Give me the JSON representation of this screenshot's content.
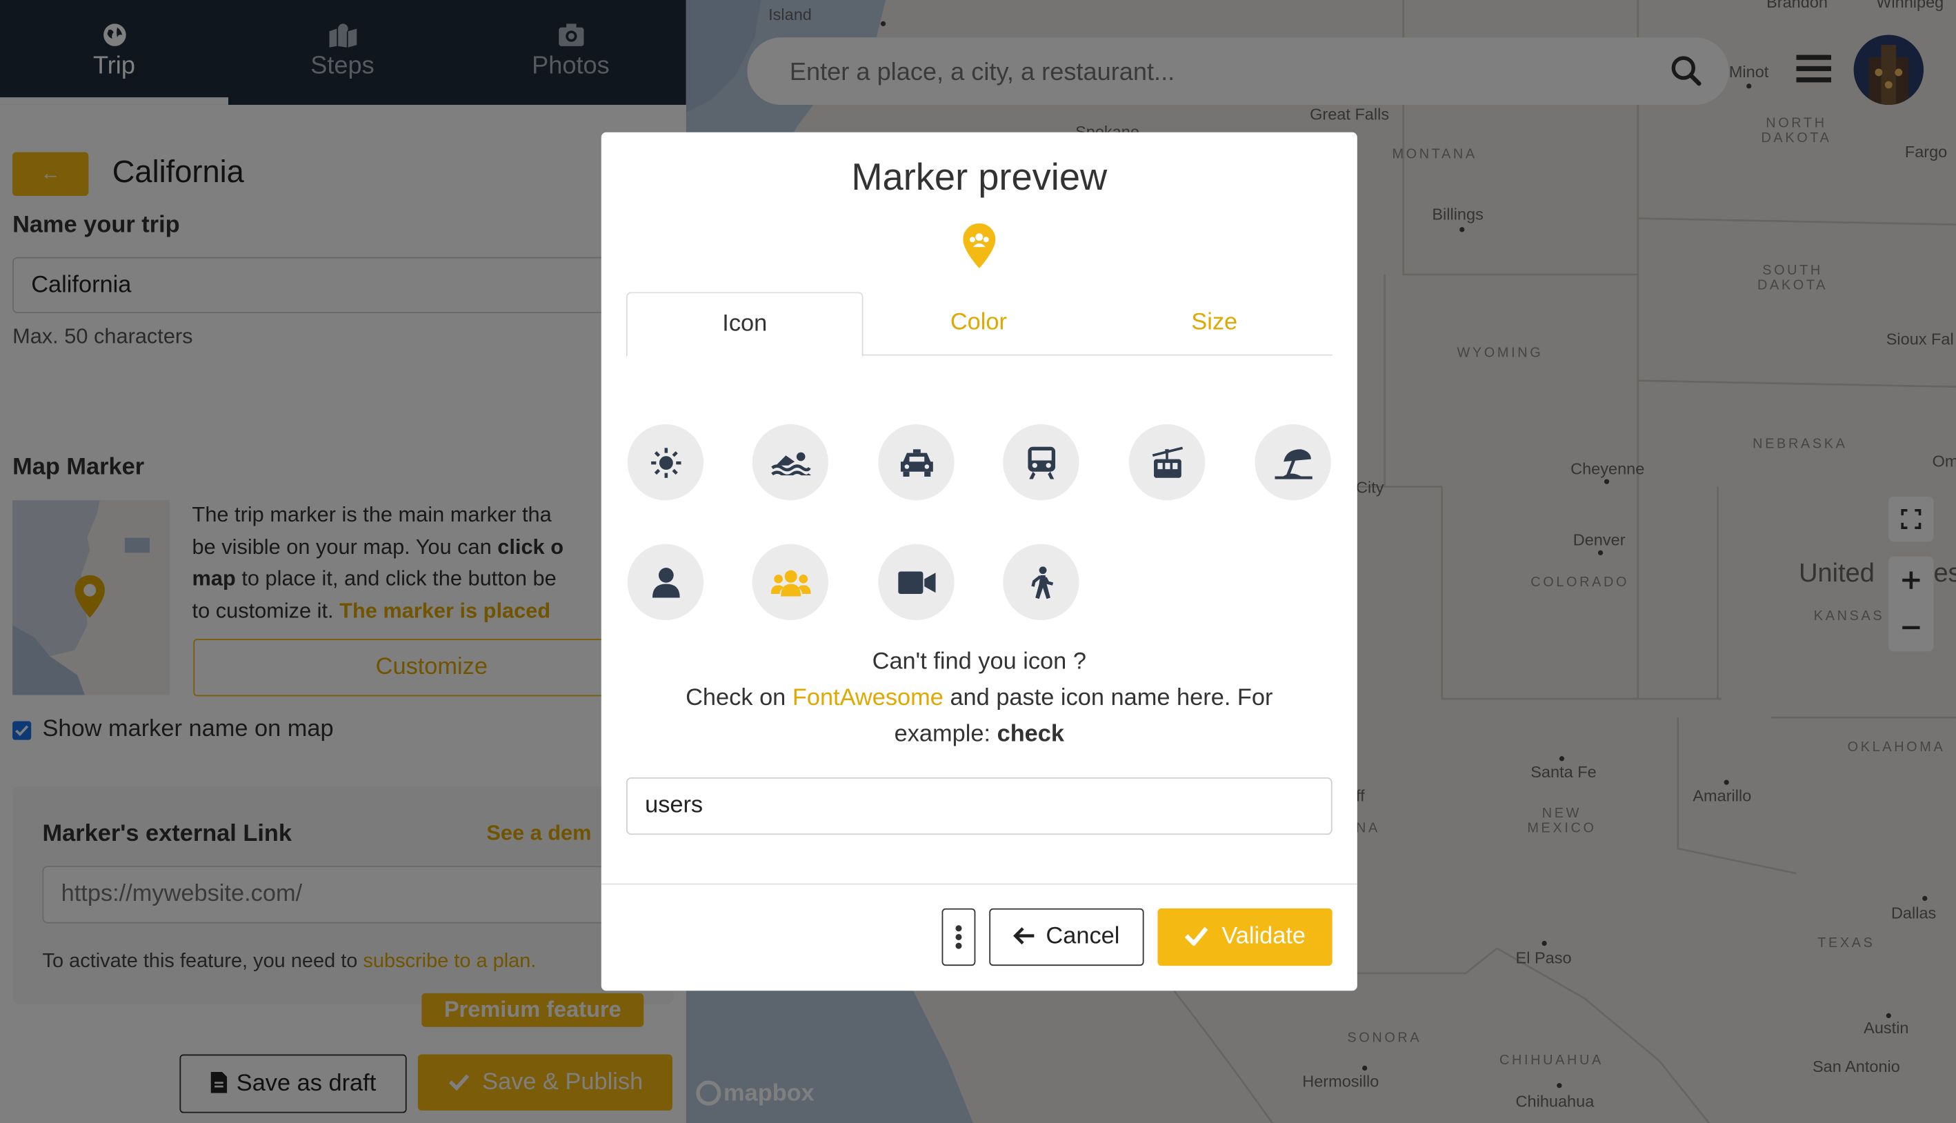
{
  "tabs": [
    {
      "label": "Trip",
      "icon": "globe-icon",
      "active": true
    },
    {
      "label": "Steps",
      "icon": "map-marked-icon",
      "active": false
    },
    {
      "label": "Photos",
      "icon": "camera-icon",
      "active": false
    }
  ],
  "trip": {
    "title": "California",
    "name_label": "Name your trip",
    "name_value": "California",
    "name_hint": "Max. 50 characters"
  },
  "marker": {
    "section_label": "Map Marker",
    "desc_1": "The trip marker is the main marker tha",
    "desc_2a": "be visible on your map. You can ",
    "desc_2b": "click o",
    "desc_3a": "map",
    "desc_3b": " to place it, and click the button be",
    "desc_4a": "to customize it. ",
    "desc_4b": "The marker is placed",
    "customize_label": "Customize",
    "show_name_label": "Show marker name on map",
    "show_name_checked": true
  },
  "external_link": {
    "label": "Marker's external Link",
    "demo_link": "See a dem",
    "placeholder": "https://mywebsite.com/",
    "notice": "To activate this feature, you need to ",
    "notice_link": "subscribe to a plan.",
    "premium_badge": "Premium feature"
  },
  "footer_buttons": {
    "draft": "Save as draft",
    "publish": "Save & Publish"
  },
  "search": {
    "placeholder": "Enter a place, a city, a restaurant..."
  },
  "map": {
    "attribution": "mapbox",
    "labels": [
      "Island",
      "Great Falls",
      "Spokane",
      "MONTANA",
      "Billings",
      "NORTH DAKOTA",
      "Fargo",
      "SOUTH DAKOTA",
      "WYOMING",
      "Sioux Fal",
      "NEBRASKA",
      "Cheyenne",
      "City",
      "Om",
      "Denver",
      "COLORADO",
      "United",
      "es",
      "KANSAS",
      "OKLAHOMA",
      "Amarillo",
      "Santa Fe",
      "NEW MEXICO",
      "ff",
      "NA",
      "Dallas",
      "TEXAS",
      "El Paso",
      "SONORA",
      "Hermosillo",
      "CHIHUAHUA",
      "Chihuahua",
      "Austin",
      "San Antonio",
      "Minot",
      "Brandon",
      "Winnipeg"
    ]
  },
  "modal": {
    "title": "Marker preview",
    "tabs": [
      "Icon",
      "Color",
      "Size"
    ],
    "icons": [
      "sun-icon",
      "swimmer-icon",
      "taxi-icon",
      "train-icon",
      "tram-icon",
      "umbrella-beach-icon",
      "user-icon",
      "users-icon",
      "video-icon",
      "walking-icon"
    ],
    "help_line1": "Can't find you icon ?",
    "help_line2a": "Check on ",
    "help_link": "FontAwesome",
    "help_line2b": " and paste icon name here. For",
    "help_line3a": "example: ",
    "help_example": "check",
    "icon_input_value": "users",
    "cancel_label": "Cancel",
    "validate_label": "Validate"
  },
  "colors": {
    "accent": "#f5b913",
    "navbar": "#1f2d3d",
    "icon": "#2f3c4d"
  }
}
